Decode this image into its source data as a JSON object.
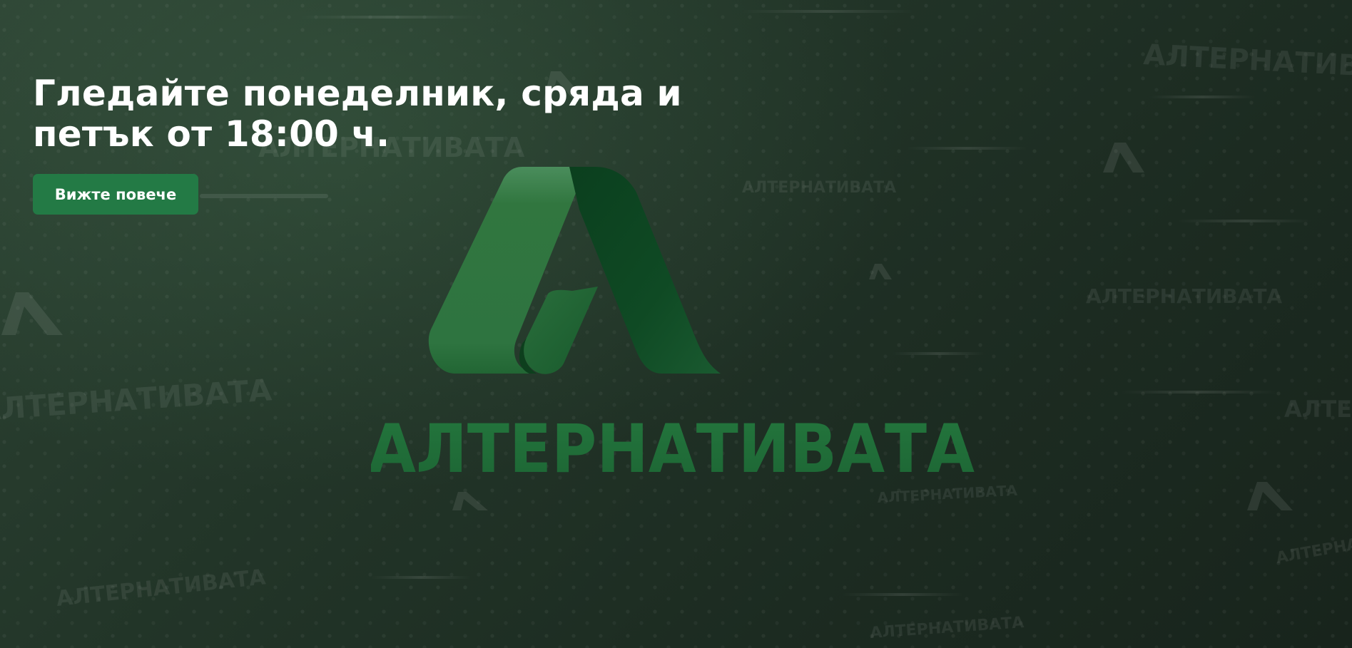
{
  "hero": {
    "headline_line1": "Гледайте понеделник, сряда и",
    "headline_line2": "петък от 18:00 ч.",
    "cta_label": "Вижте повече"
  },
  "logo": {
    "wordmark": "АЛТЕРНАТИВАТА",
    "icon": "alternativata-a-icon"
  },
  "background": {
    "watermark_text": "АЛТЕРНАТИВАТА"
  },
  "colors": {
    "background": "#1d2a22",
    "button": "#237a45",
    "logo_light": "#2f7a45",
    "logo_dark": "#0f4a23"
  }
}
